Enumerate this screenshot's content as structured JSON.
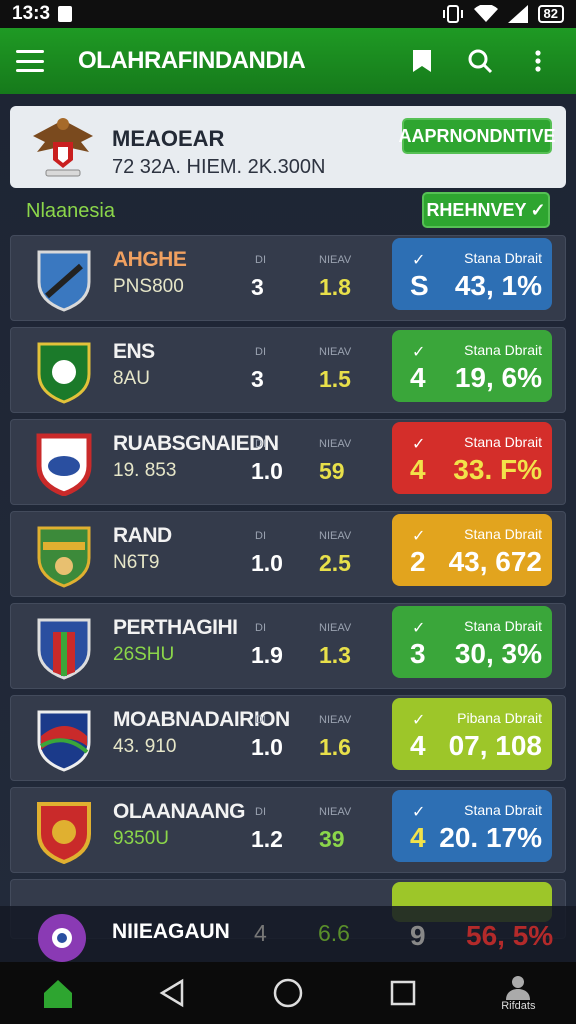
{
  "status": {
    "time": "13:3",
    "battery": "82"
  },
  "app": {
    "title": "OLAHRAFINDANDIA"
  },
  "header": {
    "title": "MEAOEAR",
    "subtitle": "72 32A. HIEM. 2K.300N",
    "button": "AAPRNONDNTIVE"
  },
  "section": {
    "label": "Nlaanesia",
    "button": "RHEHNVEY"
  },
  "rows": [
    {
      "name": "AHGHE",
      "sub": "PNS800",
      "col1": "DI",
      "col2": "NIEAV",
      "v1": "3",
      "v2": "1.8",
      "pill_label": "Stana Dbrait",
      "big": "S",
      "pct": "43, 1%",
      "pill_color": "#2d6fb4"
    },
    {
      "name": "ENS",
      "sub": "8AU",
      "col1": "DI",
      "col2": "NIEAV",
      "v1": "3",
      "v2": "1.5",
      "pill_label": "Stana Dbrait",
      "big": "4",
      "pct": "19, 6%",
      "pill_color": "#3aa63a"
    },
    {
      "name": "RUABSGNAIEDN",
      "sub": "19. 853",
      "col1": "DI",
      "col2": "NIEAV",
      "v1": "1.0",
      "v2": "59",
      "pill_label": "Stana Dbrait",
      "big": "4",
      "pct": "33. F%",
      "pill_color": "#d42e2a"
    },
    {
      "name": "RAND",
      "sub": "N6T9",
      "col1": "DI",
      "col2": "NIEAV",
      "v1": "1.0",
      "v2": "2.5",
      "pill_label": "Stana Dbrait",
      "big": "2",
      "pct": "43, 672",
      "pill_color": "#e2a41e"
    },
    {
      "name": "PERTHAGIHI",
      "sub": "26SHU",
      "col1": "DI",
      "col2": "NIEAV",
      "v1": "1.9",
      "v2": "1.3",
      "pill_label": "Stana Dbrait",
      "big": "3",
      "pct": "30, 3%",
      "pill_color": "#3aa63a"
    },
    {
      "name": "MOABNADAIRION",
      "sub": "43. 910",
      "col1": "DI",
      "col2": "NIEAV",
      "v1": "1.0",
      "v2": "1.6",
      "pill_label": "Pibana Dbrait",
      "big": "4",
      "pct": "07, 108",
      "pill_color": "#9dc629"
    },
    {
      "name": "OLAANAANG",
      "sub": "9350U",
      "col1": "DI",
      "col2": "NIEAV",
      "v1": "1.2",
      "v2": "39",
      "pill_label": "Stana Dbrait",
      "big": "4",
      "pct": "20. 17%",
      "pill_color": "#2d6fb4"
    }
  ],
  "overlay_row": {
    "name": "NIIEAGAUN",
    "v1": "4",
    "v2": "6.6",
    "big": "9",
    "pct": "56, 5%"
  },
  "nav": {
    "profile_label": "Rifdats"
  }
}
